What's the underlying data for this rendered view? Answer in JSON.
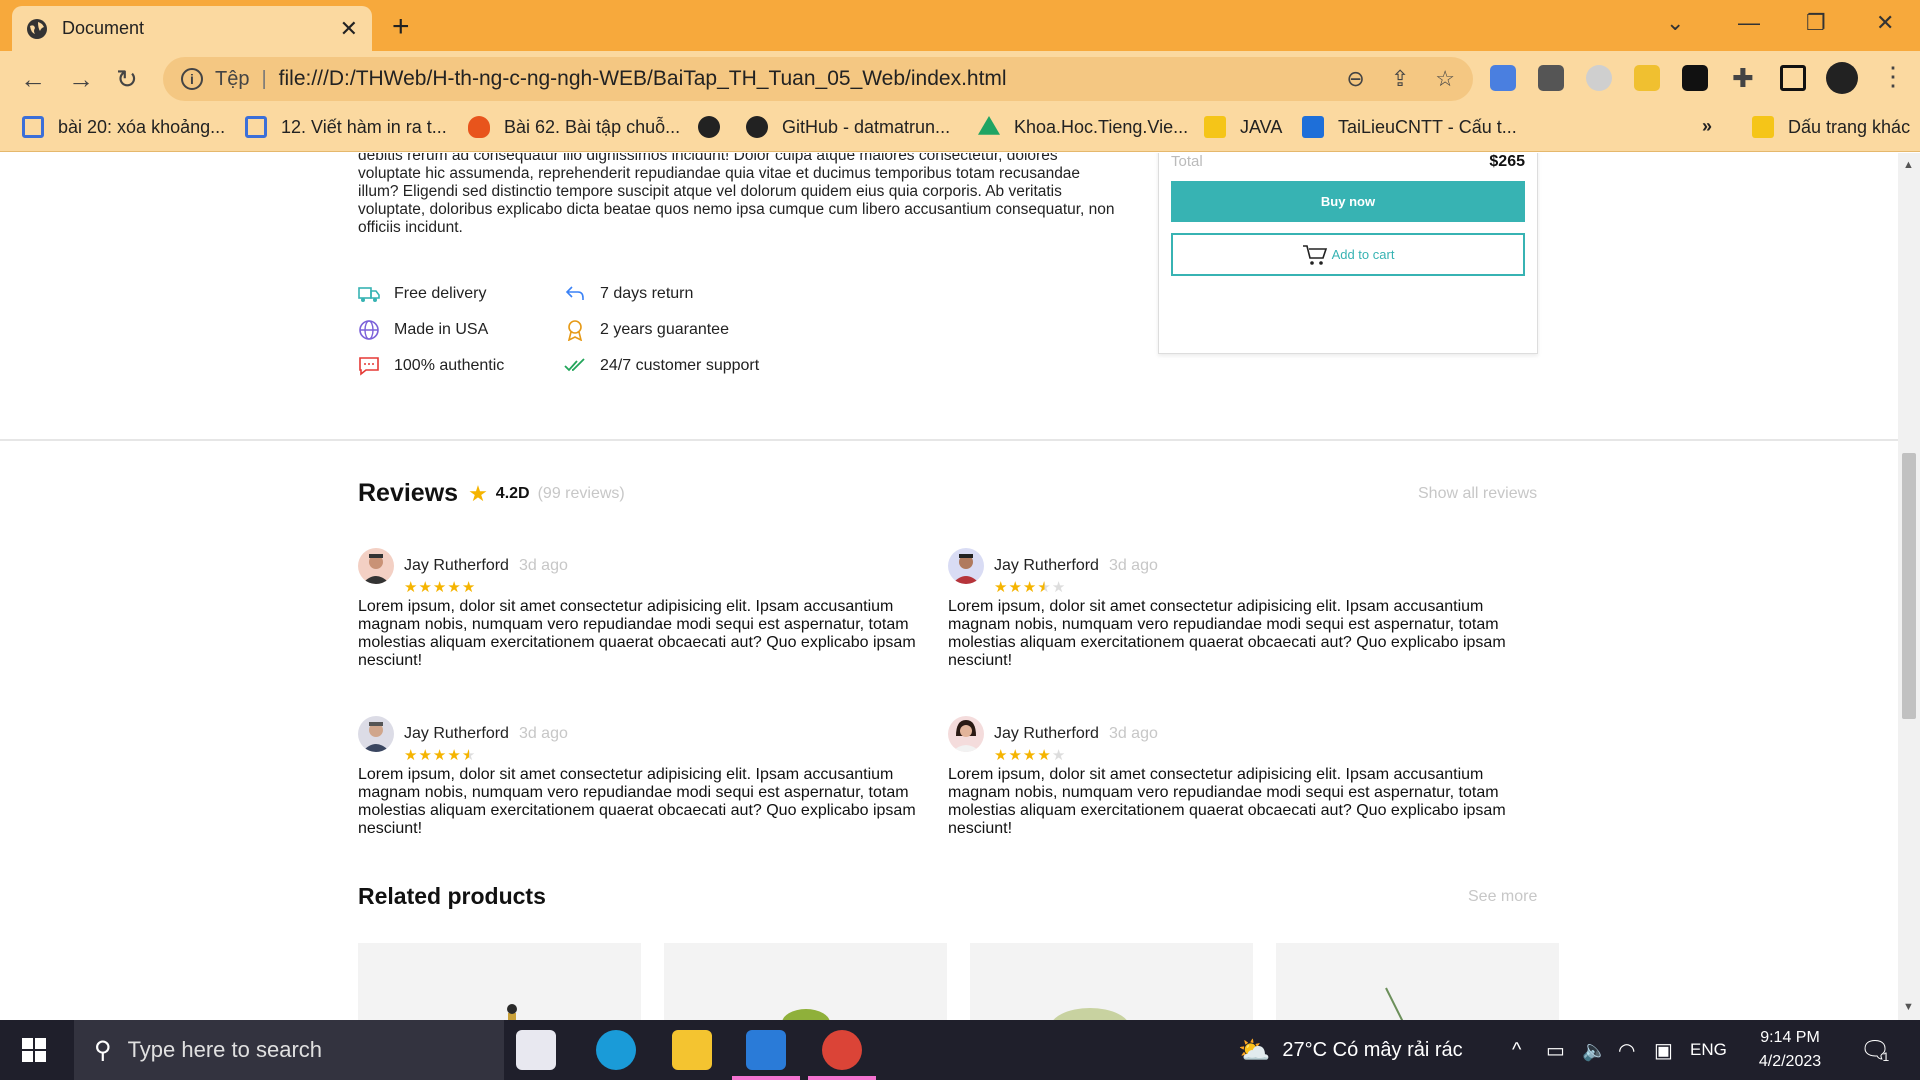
{
  "browser": {
    "tab_title": "Document",
    "close_tab": "✕",
    "new_tab": "+",
    "address": {
      "scheme_label": "Tệp",
      "separator": "|",
      "url": "file:///D:/THWeb/H-th-ng-c-ng-ngh-WEB/BaiTap_TH_Tuan_05_Web/index.html"
    },
    "bookmarks": [
      {
        "label": "bài 20: xóa khoảng...",
        "icon": "doc-icon",
        "color": "#3b6fd8"
      },
      {
        "label": "12. Viết hàm in ra t...",
        "icon": "doc-icon",
        "color": "#3b6fd8"
      },
      {
        "label": "Bài 62. Bài tập chuỗ...",
        "icon": "flame-icon",
        "color": "#e8541c"
      },
      {
        "label": "",
        "icon": "globe-icon",
        "color": "#222222"
      },
      {
        "label": "GitHub - datmatrun...",
        "icon": "github-icon",
        "color": "#222222"
      },
      {
        "label": "Khoa.Hoc.Tieng.Vie...",
        "icon": "drive-icon",
        "color": "#1fa463"
      },
      {
        "label": "JAVA",
        "icon": "folder-icon",
        "color": "#f5c518"
      },
      {
        "label": "TaiLieuCNTT - Cấu t...",
        "icon": "site-icon",
        "color": "#1e6fd9"
      }
    ],
    "overflow_label": "»",
    "other_bookmarks": "Dấu trang khác"
  },
  "product": {
    "description_fragment": "debitis rerum ad consequatur illo dignissimos incidunt! Dolor culpa atque maiores consectetur, dolores voluptate hic assumenda, reprehenderit repudiandae quia vitae et ducimus temporibus totam recusandae illum? Eligendi sed distinctio tempore suscipit atque vel dolorum quidem eius quia corporis. Ab veritatis voluptate, doloribus explicabo dicta beatae quos nemo ipsa cumque cum libero accusantium consequatur, non officiis incidunt.",
    "features": [
      {
        "label": "Free delivery",
        "icon": "truck-icon"
      },
      {
        "label": "7 days return",
        "icon": "return-icon"
      },
      {
        "label": "Made in USA",
        "icon": "globe-icon"
      },
      {
        "label": "2 years guarantee",
        "icon": "award-icon"
      },
      {
        "label": "100% authentic",
        "icon": "chat-icon"
      },
      {
        "label": "24/7 customer support",
        "icon": "double-check-icon"
      }
    ],
    "total_label": "Total",
    "total_value": "$265",
    "buy_now": "Buy now",
    "add_to_cart": "Add to cart",
    "accent_color": "#37b3b3"
  },
  "reviews": {
    "title": "Reviews",
    "rating": "4.2D",
    "count": "(99 reviews)",
    "show_all": "Show all reviews",
    "items": [
      {
        "name": "Jay Rutherford",
        "time": "3d ago",
        "stars": 5,
        "text": "Lorem ipsum, dolor sit amet consectetur adipisicing elit. Ipsam accusantium magnam nobis, numquam vero repudiandae modi sequi est aspernatur, totam molestias aliquam exercitationem quaerat obcaecati aut? Quo explicabo ipsam nesciunt!"
      },
      {
        "name": "Jay Rutherford",
        "time": "3d ago",
        "stars": 3.5,
        "text": "Lorem ipsum, dolor sit amet consectetur adipisicing elit. Ipsam accusantium magnam nobis, numquam vero repudiandae modi sequi est aspernatur, totam molestias aliquam exercitationem quaerat obcaecati aut? Quo explicabo ipsam nesciunt!"
      },
      {
        "name": "Jay Rutherford",
        "time": "3d ago",
        "stars": 4.5,
        "text": "Lorem ipsum, dolor sit amet consectetur adipisicing elit. Ipsam accusantium magnam nobis, numquam vero repudiandae modi sequi est aspernatur, totam molestias aliquam exercitationem quaerat obcaecati aut? Quo explicabo ipsam nesciunt!"
      },
      {
        "name": "Jay Rutherford",
        "time": "3d ago",
        "stars": 4,
        "text": "Lorem ipsum, dolor sit amet consectetur adipisicing elit. Ipsam accusantium magnam nobis, numquam vero repudiandae modi sequi est aspernatur, totam molestias aliquam exercitationem quaerat obcaecati aut? Quo explicabo ipsam nesciunt!"
      }
    ]
  },
  "related": {
    "title": "Related products",
    "see_more": "See more"
  },
  "taskbar": {
    "search_placeholder": "Type here to search",
    "weather": "27°C  Có mây rải rác",
    "language": "ENG",
    "time": "9:14 PM",
    "date": "4/2/2023",
    "notifications": "1"
  }
}
